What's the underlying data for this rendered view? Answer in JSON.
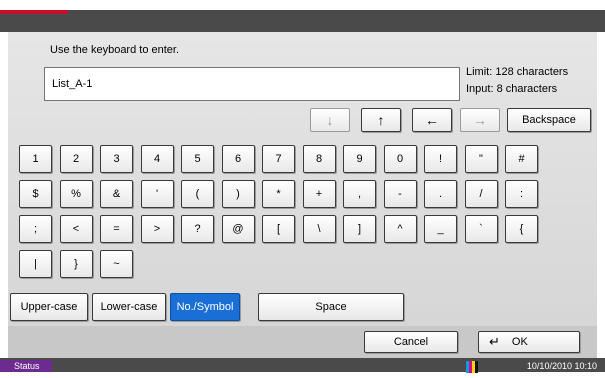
{
  "header": {
    "title": ""
  },
  "instruction": "Use the keyboard to enter.",
  "input": {
    "value": "List_A-1"
  },
  "limit_text": "Limit: 128 characters",
  "input_count_text": "Input:   8 characters",
  "nav_keys": [
    {
      "symbol": "↓",
      "name": "arrow-down-icon",
      "enabled": false
    },
    {
      "symbol": "↑",
      "name": "arrow-up-icon",
      "enabled": true
    },
    {
      "symbol": "←",
      "name": "arrow-left-icon",
      "enabled": true
    },
    {
      "symbol": "→",
      "name": "arrow-right-icon",
      "enabled": false
    }
  ],
  "backspace_label": "Backspace",
  "keyboard_rows": [
    [
      "1",
      "2",
      "3",
      "4",
      "5",
      "6",
      "7",
      "8",
      "9",
      "0",
      "!",
      "\"",
      "#"
    ],
    [
      "$",
      "%",
      "&",
      "'",
      "(",
      ")",
      "*",
      "+",
      ",",
      "-",
      ".",
      "/",
      ":"
    ],
    [
      ";",
      "<",
      "=",
      ">",
      "?",
      "@",
      "[",
      "\\",
      "]",
      "^",
      "_",
      "`",
      "{"
    ],
    [
      "|",
      "}",
      "~"
    ]
  ],
  "mode_buttons": [
    {
      "label": "Upper-case",
      "selected": false
    },
    {
      "label": "Lower-case",
      "selected": false
    },
    {
      "label": "No./Symbol",
      "selected": true
    }
  ],
  "space_label": "Space",
  "cancel_label": "Cancel",
  "ok_label": "OK",
  "status_label": "Status",
  "datetime": "10/10/2010  10:10",
  "colors": {
    "accent_red": "#c8102e",
    "selected_blue": "#1a6fd6",
    "status_purple": "#6d2b8f"
  }
}
